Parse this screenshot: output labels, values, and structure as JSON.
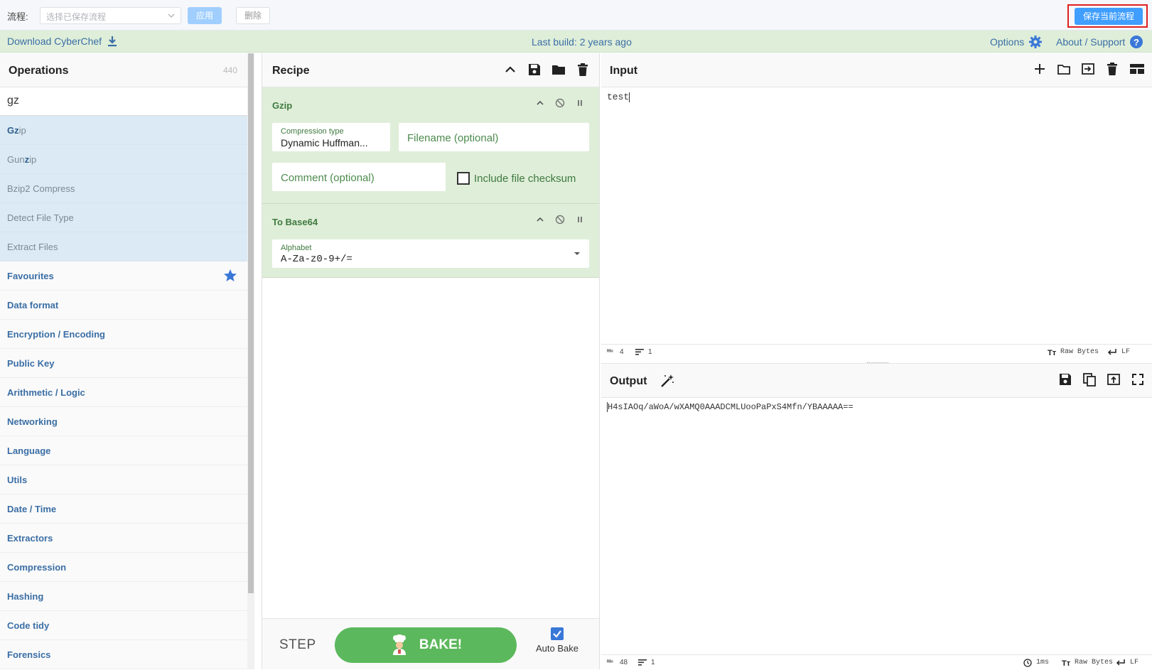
{
  "flowbar": {
    "label": "流程:",
    "select_placeholder": "选择已保存流程",
    "apply_label": "应用",
    "delete_label": "删除",
    "save_label": "保存当前流程"
  },
  "banner": {
    "download_label": "Download CyberChef",
    "last_build": "Last build: 2 years ago",
    "options_label": "Options",
    "about_label": "About / Support"
  },
  "operations": {
    "title": "Operations",
    "count": "440",
    "search_value": "gz",
    "results": [
      {
        "match": "Gz",
        "rest": "ip"
      },
      {
        "pre": "Gun",
        "match": "z",
        "rest": "ip"
      },
      {
        "text": "Bzip2 Compress"
      },
      {
        "text": "Detect File Type"
      },
      {
        "text": "Extract Files"
      }
    ],
    "categories": [
      "Favourites",
      "Data format",
      "Encryption / Encoding",
      "Public Key",
      "Arithmetic / Logic",
      "Networking",
      "Language",
      "Utils",
      "Date / Time",
      "Extractors",
      "Compression",
      "Hashing",
      "Code tidy",
      "Forensics"
    ]
  },
  "recipe": {
    "title": "Recipe",
    "gzip": {
      "name": "Gzip",
      "compression_label": "Compression type",
      "compression_value": "Dynamic Huffman...",
      "filename_placeholder": "Filename (optional)",
      "comment_placeholder": "Comment (optional)",
      "checksum_label": "Include file checksum"
    },
    "base64": {
      "name": "To Base64",
      "alphabet_label": "Alphabet",
      "alphabet_value": "A-Za-z0-9+/="
    },
    "step_label": "STEP",
    "bake_label": "BAKE!",
    "autobake_label": "Auto Bake"
  },
  "input": {
    "title": "Input",
    "text": "test",
    "status_abc_label": "ᴿᴮᶜ",
    "status_chars": "4",
    "status_lines": "1",
    "encoding": "Raw Bytes",
    "eol": "LF"
  },
  "output": {
    "title": "Output",
    "text": "H4sIAOq/aWoA/wXAMQ0AAADCMLUooPaPxS4Mfn/YBAAAAA==",
    "status_abc_label": "ᴿᴮᶜ",
    "status_chars": "48",
    "status_lines": "1",
    "time": "1ms",
    "encoding": "Raw Bytes",
    "eol": "LF"
  },
  "colors": {
    "accent_blue": "#409eff",
    "recipe_green": "#dfeed9",
    "bake_green": "#5cb85c",
    "highlight_red": "#e02020"
  }
}
